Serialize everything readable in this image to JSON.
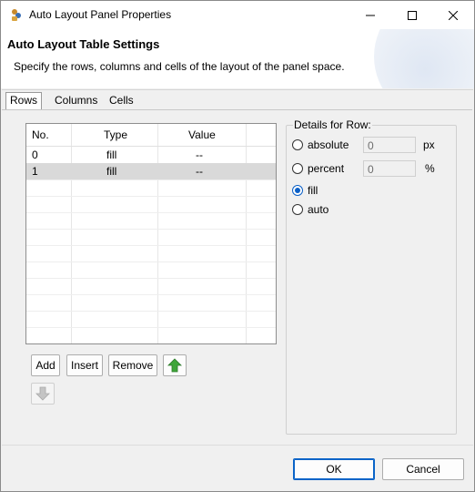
{
  "window": {
    "title": "Auto Layout Panel Properties"
  },
  "header": {
    "title": "Auto Layout Table Settings",
    "description": "Specify the rows, columns and cells of the layout of the panel space."
  },
  "tabs": [
    {
      "label": "Rows",
      "active": true
    },
    {
      "label": "Columns",
      "active": false
    },
    {
      "label": "Cells",
      "active": false
    }
  ],
  "table": {
    "columns": [
      "No.",
      "Type",
      "Value"
    ],
    "rows": [
      {
        "no": "0",
        "type": "fill",
        "value": "--",
        "selected": false
      },
      {
        "no": "1",
        "type": "fill",
        "value": "--",
        "selected": true
      }
    ]
  },
  "buttons": {
    "add": "Add",
    "insert": "Insert",
    "remove": "Remove"
  },
  "details": {
    "title": "Details for Row:",
    "options": [
      {
        "label": "absolute",
        "selected": false,
        "value": "0",
        "unit": "px"
      },
      {
        "label": "percent",
        "selected": false,
        "value": "0",
        "unit": "%"
      },
      {
        "label": "fill",
        "selected": true
      },
      {
        "label": "auto",
        "selected": false
      }
    ]
  },
  "footer": {
    "ok": "OK",
    "cancel": "Cancel"
  },
  "colors": {
    "accent": "#0a5fc7",
    "arrow_up": "#3fa63a",
    "arrow_disabled": "#c4c4c4"
  }
}
